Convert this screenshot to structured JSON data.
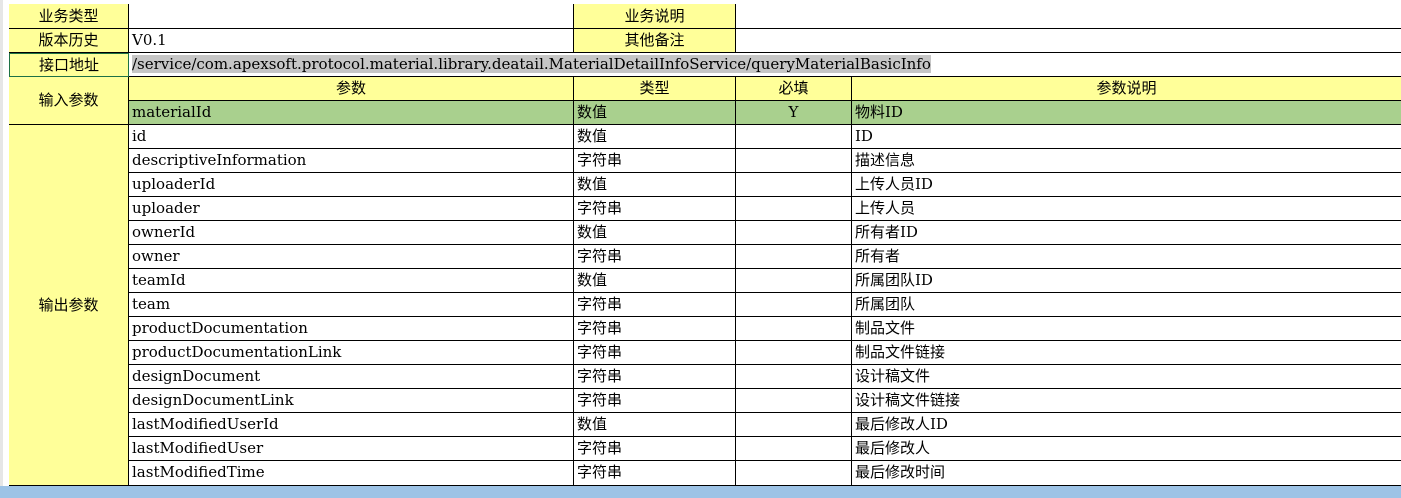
{
  "colors": {
    "label_bg": "#ffff99",
    "header_bg": "#a9d08e",
    "selection_strip": "#9dc3e6"
  },
  "labels": {
    "business_type": "业务类型",
    "business_desc": "业务说明",
    "version_history": "版本历史",
    "other_notes": "其他备注",
    "api_address": "接口地址",
    "input_params": "输入参数",
    "output_params": "输出参数"
  },
  "values": {
    "business_type": "",
    "business_desc": "",
    "version": "V0.1",
    "other_notes": "",
    "api_url": "/service/com.apexsoft.protocol.material.library.deatail.MaterialDetailInfoService/queryMaterialBasicInfo"
  },
  "columns": {
    "param": "参数",
    "type": "类型",
    "required": "必填",
    "desc": "参数说明"
  },
  "input_row": {
    "param": "materialId",
    "type": "数值",
    "required": "Y",
    "desc": "物料ID"
  },
  "output_rows": [
    {
      "param": "id",
      "type": "数值",
      "desc": "ID"
    },
    {
      "param": "descriptiveInformation",
      "type": "字符串",
      "desc": "描述信息"
    },
    {
      "param": "uploaderId",
      "type": "数值",
      "desc": "上传人员ID"
    },
    {
      "param": "uploader",
      "type": "字符串",
      "desc": "上传人员"
    },
    {
      "param": "ownerId",
      "type": "数值",
      "desc": "所有者ID"
    },
    {
      "param": "owner",
      "type": "字符串",
      "desc": "所有者"
    },
    {
      "param": "teamId",
      "type": "数值",
      "desc": "所属团队ID"
    },
    {
      "param": "team",
      "type": "字符串",
      "desc": "所属团队"
    },
    {
      "param": "productDocumentation",
      "type": "字符串",
      "desc": "制品文件"
    },
    {
      "param": "productDocumentationLink",
      "type": "字符串",
      "desc": "制品文件链接"
    },
    {
      "param": "designDocument",
      "type": "字符串",
      "desc": "设计稿文件"
    },
    {
      "param": "designDocumentLink",
      "type": "字符串",
      "desc": "设计稿文件链接"
    },
    {
      "param": "lastModifiedUserId",
      "type": "数值",
      "desc": "最后修改人ID"
    },
    {
      "param": "lastModifiedUser",
      "type": "字符串",
      "desc": "最后修改人"
    },
    {
      "param": "lastModifiedTime",
      "type": "字符串",
      "desc": "最后修改时间"
    }
  ]
}
